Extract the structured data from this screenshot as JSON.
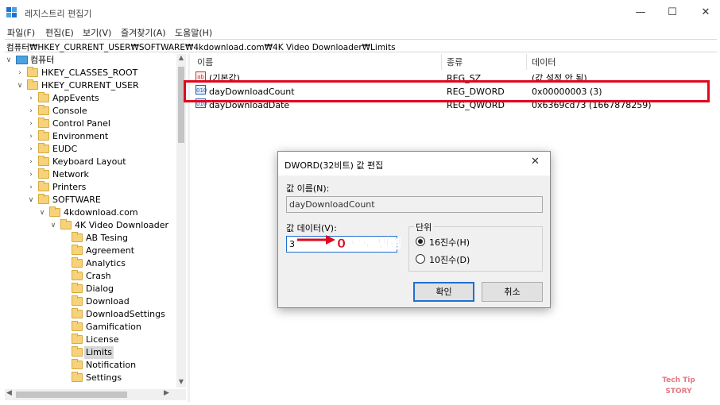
{
  "window": {
    "title": "레지스트리 편집기",
    "minimize_glyph": "—",
    "maximize_glyph": "☐",
    "close_glyph": "✕"
  },
  "menu": [
    "파일(F)",
    "편집(E)",
    "보기(V)",
    "즐겨찾기(A)",
    "도움말(H)"
  ],
  "address": "컴퓨터₩HKEY_CURRENT_USER₩SOFTWARE₩4kdownload.com₩4K Video Downloader₩Limits",
  "tree": {
    "items": [
      {
        "label": "컴퓨터",
        "level": 0,
        "chevron": "∨",
        "icon": "computer-icon"
      },
      {
        "label": "HKEY_CLASSES_ROOT",
        "level": 1,
        "chevron": "›"
      },
      {
        "label": "HKEY_CURRENT_USER",
        "level": 1,
        "chevron": "∨"
      },
      {
        "label": "AppEvents",
        "level": 2,
        "chevron": "›"
      },
      {
        "label": "Console",
        "level": 2,
        "chevron": "›"
      },
      {
        "label": "Control Panel",
        "level": 2,
        "chevron": "›"
      },
      {
        "label": "Environment",
        "level": 2,
        "chevron": "›"
      },
      {
        "label": "EUDC",
        "level": 2,
        "chevron": "›"
      },
      {
        "label": "Keyboard Layout",
        "level": 2,
        "chevron": "›"
      },
      {
        "label": "Network",
        "level": 2,
        "chevron": "›"
      },
      {
        "label": "Printers",
        "level": 2,
        "chevron": "›"
      },
      {
        "label": "SOFTWARE",
        "level": 2,
        "chevron": "∨"
      },
      {
        "label": "4kdownload.com",
        "level": 3,
        "chevron": "∨"
      },
      {
        "label": "4K Video Downloader",
        "level": 4,
        "chevron": "∨"
      },
      {
        "label": "AB Tesing",
        "level": 5,
        "chevron": ""
      },
      {
        "label": "Agreement",
        "level": 5,
        "chevron": ""
      },
      {
        "label": "Analytics",
        "level": 5,
        "chevron": ""
      },
      {
        "label": "Crash",
        "level": 5,
        "chevron": ""
      },
      {
        "label": "Dialog",
        "level": 5,
        "chevron": ""
      },
      {
        "label": "Download",
        "level": 5,
        "chevron": ""
      },
      {
        "label": "DownloadSettings",
        "level": 5,
        "chevron": ""
      },
      {
        "label": "Gamification",
        "level": 5,
        "chevron": ""
      },
      {
        "label": "License",
        "level": 5,
        "chevron": ""
      },
      {
        "label": "Limits",
        "level": 5,
        "chevron": "",
        "selected": true
      },
      {
        "label": "Notification",
        "level": 5,
        "chevron": ""
      },
      {
        "label": "Settings",
        "level": 5,
        "chevron": ""
      }
    ]
  },
  "list": {
    "columns": {
      "name": "이름",
      "type": "종류",
      "data": "데이터"
    },
    "rows": [
      {
        "icon": "ab",
        "name": "(기본값)",
        "type": "REG_SZ",
        "data": "(값 설정 안 됨)"
      },
      {
        "icon": "010",
        "name": "dayDownloadCount",
        "type": "REG_DWORD",
        "data": "0x00000003 (3)"
      },
      {
        "icon": "010",
        "name": "dayDownloadDate",
        "type": "REG_QWORD",
        "data": "0x6369cd73 (1667878259)"
      }
    ]
  },
  "dialog": {
    "title": "DWORD(32비트) 값 편집",
    "close_glyph": "✕",
    "value_name_label": "값 이름(N):",
    "value_name": "dayDownloadCount",
    "value_data_label": "값 데이터(V):",
    "value_data": "3",
    "base_label": "단위",
    "base_hex": "16진수(H)",
    "base_dec": "10진수(D)",
    "ok": "확인",
    "cancel": "취소"
  },
  "annotation": "0 으로 변경",
  "watermark": {
    "line1": "Tech Tip",
    "line2": "STORY"
  },
  "colors": {
    "highlight": "#e0081f",
    "accent": "#1f6fd1"
  }
}
